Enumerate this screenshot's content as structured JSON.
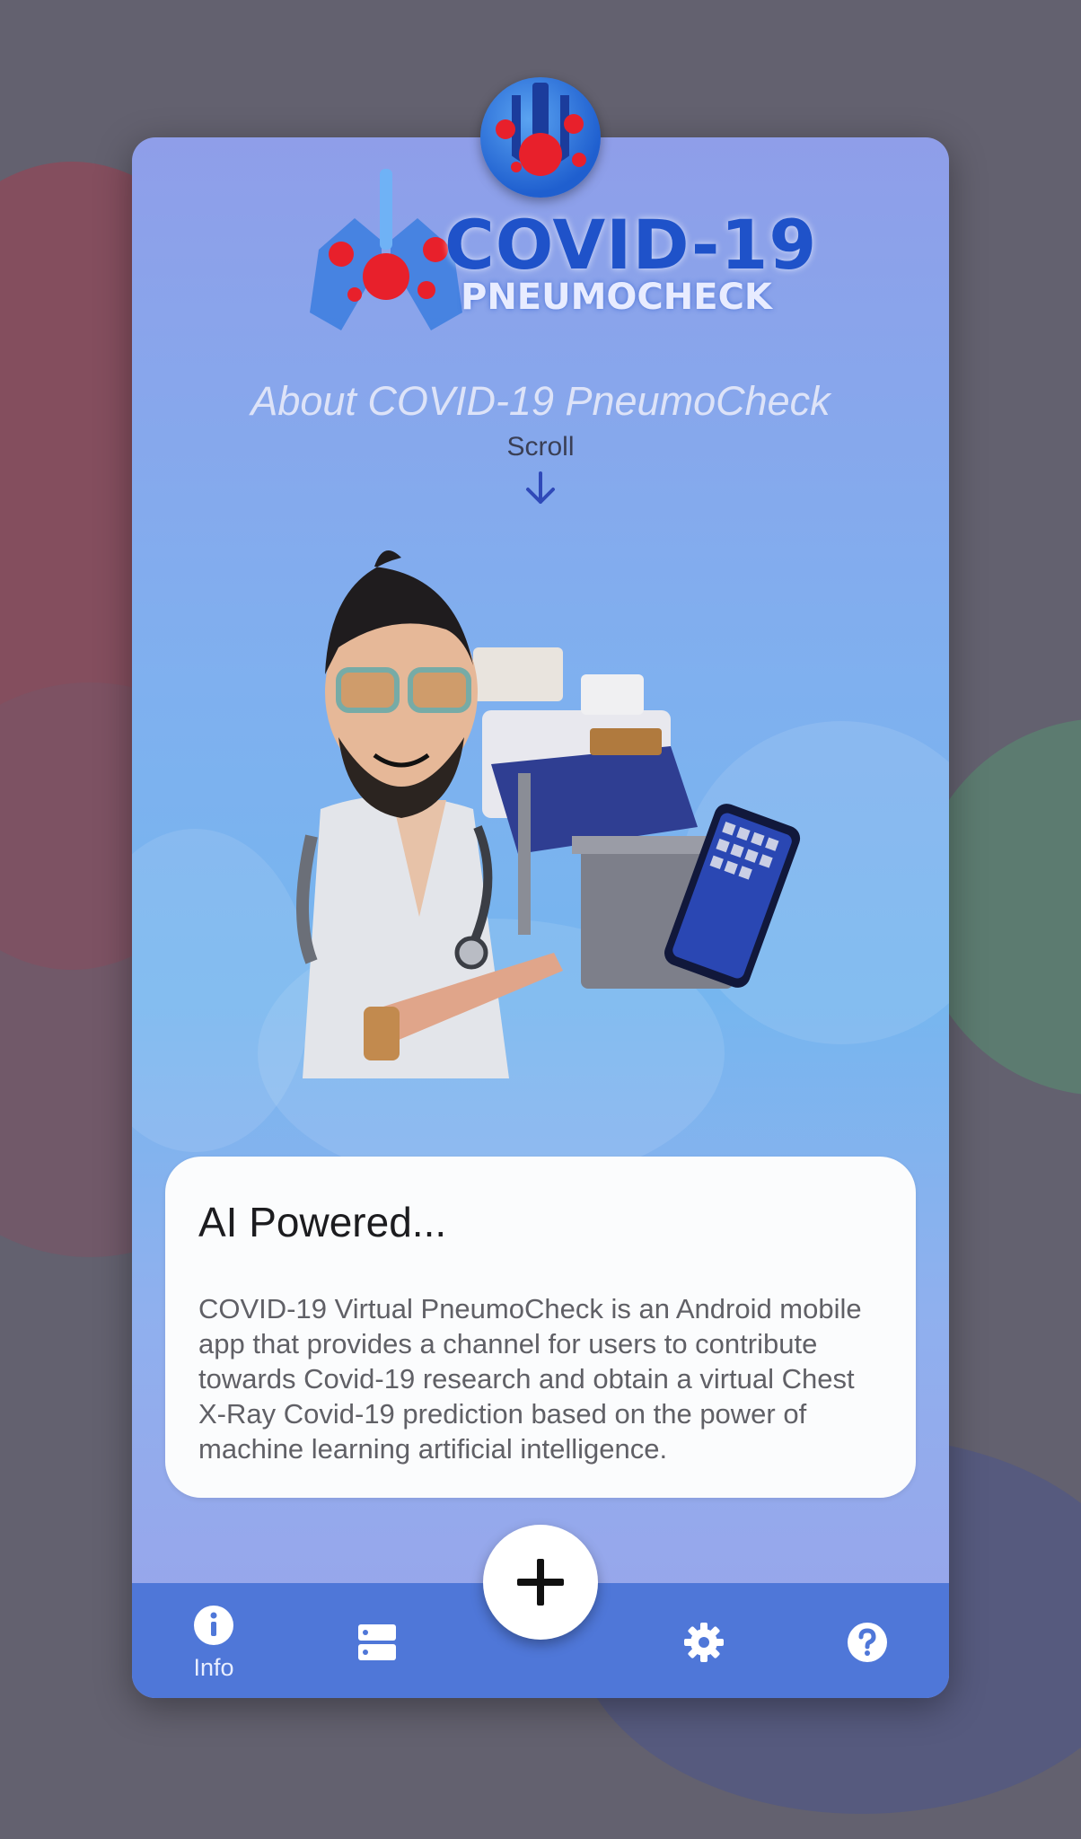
{
  "header": {
    "logo_title": "COVID-19",
    "logo_subtitle": "PNEUMOCHECK",
    "about_title": "About COVID-19 PneumoCheck",
    "scroll_label": "Scroll"
  },
  "info_card": {
    "title": "AI Powered...",
    "body": "COVID-19 Virtual PneumoCheck is an Android mobile app that provides a channel for users to contribute towards Covid-19 research and obtain a virtual Chest X-Ray Covid-19 prediction based on the power of machine learning artificial intelligence."
  },
  "bottom_nav": {
    "items": [
      {
        "label": "Info",
        "icon": "info-icon",
        "active": true
      },
      {
        "label": "",
        "icon": "storage-icon",
        "active": false
      },
      {
        "label": "",
        "icon": "gear-icon",
        "active": false
      },
      {
        "label": "",
        "icon": "help-icon",
        "active": false
      }
    ],
    "fab_icon": "plus-icon"
  },
  "colors": {
    "brand_blue": "#1f52c9",
    "nav_bar": "#4f77d8",
    "background": "#63616f"
  }
}
